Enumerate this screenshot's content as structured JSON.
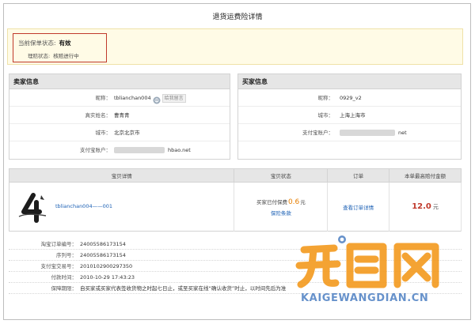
{
  "page": {
    "title": "退货运费险详情"
  },
  "status": {
    "policy_label": "当前保单状态:",
    "policy_value": "有效",
    "claim_label": "理赔状态:",
    "claim_value": "核赔进行中"
  },
  "seller": {
    "heading": "卖家信息",
    "rows": [
      {
        "label": "昵称",
        "value": "tblianchan004"
      },
      {
        "label": "真实姓名",
        "value": "曹青青"
      },
      {
        "label": "城市",
        "value": "北京北京市"
      },
      {
        "label": "支付宝账户",
        "value": "hbao.net"
      }
    ],
    "ww_tag": "给我留言"
  },
  "buyer": {
    "heading": "买家信息",
    "rows": [
      {
        "label": "昵称",
        "value": "0929_v2"
      },
      {
        "label": "城市",
        "value": "上海上海市"
      },
      {
        "label": "支付宝账户",
        "value": "net"
      }
    ]
  },
  "order_table": {
    "headers": [
      "宝贝详情",
      "宝贝状态",
      "订单",
      "本单最高赔付金额"
    ],
    "item_name": "tblianchan004——001",
    "paid_prefix": "买家已付保费",
    "paid_amount": "0.6",
    "paid_unit": "元",
    "guarantee_link": "保险条款",
    "order_link": "查看订单详情",
    "max_amount": "12.0",
    "max_unit": "元"
  },
  "details": [
    {
      "label": "淘宝订单编号",
      "value": "24005586173154"
    },
    {
      "label": "序列号",
      "value": "24005586173154"
    },
    {
      "label": "支付宝交易号",
      "value": "2010102900297350"
    },
    {
      "label": "付款时间",
      "value": "2010-10-29 17:43:23"
    },
    {
      "label": "保障期限",
      "value": "自买家或买家代表签收货物之时起七日止，或至买家在线“确认收货”时止，以时间先后为准"
    }
  ],
  "watermark": {
    "logo_text": "开店网",
    "domain": "KAIGEWANGDIAN.CN"
  },
  "colors": {
    "status_border": "#c0392b",
    "link": "#1a5fb4",
    "amount_orange": "#e67e00",
    "watermark_orange": "#f39a1e",
    "watermark_blue": "#4d7fc2"
  }
}
